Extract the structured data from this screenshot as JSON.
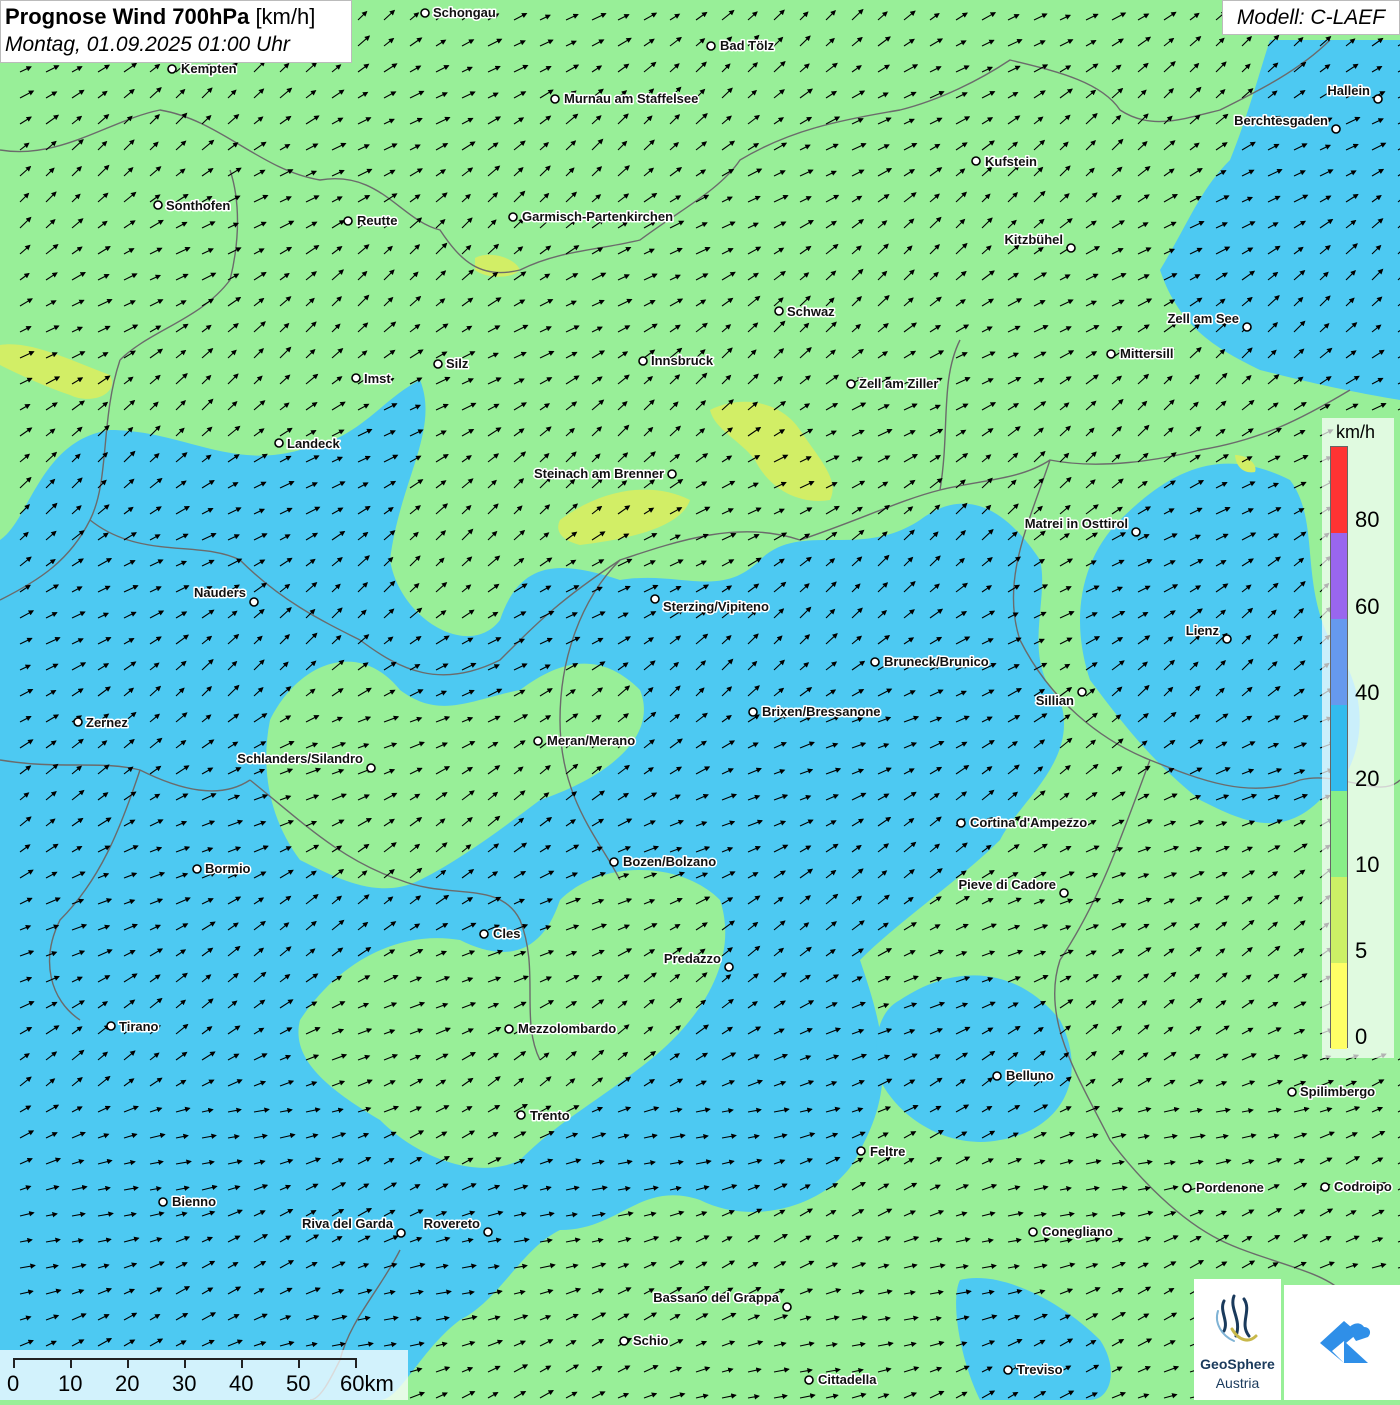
{
  "title": {
    "main": "Prognose Wind 700hPa",
    "unit": "[km/h]",
    "datetime": "Montag, 01.09.2025 01:00 Uhr"
  },
  "model": "Modell: C-LAEF",
  "legend": {
    "unit": "km/h",
    "ticks": [
      "80",
      "60",
      "40",
      "20",
      "10",
      "5",
      "0"
    ],
    "colors": [
      "#ff3333",
      "#9966ee",
      "#6699ee",
      "#33bbee",
      "#88ee88",
      "#ccf066",
      "#ffff66"
    ]
  },
  "scale_bar": {
    "labels": [
      "0",
      "10",
      "20",
      "30",
      "40",
      "50",
      "60km"
    ]
  },
  "colors": {
    "wind_0_5": "#f4f066",
    "wind_5_10": "#d2ee66",
    "wind_10_20": "#98ef98",
    "wind_20_40": "#4dc9f2",
    "arrow": "#000000",
    "border": "#6b6b6b"
  },
  "cities": [
    "Schongau",
    "Bad Tölz",
    "Kempten",
    "Murnau am Staffelsee",
    "Hallein",
    "Berchtesgaden",
    "Kufstein",
    "Sonthofen",
    "Reutte",
    "Garmisch-Partenkirchen",
    "Kitzbühel",
    "Schwaz",
    "Zell am See",
    "Mittersill",
    "Imst",
    "Silz",
    "Innsbruck",
    "Zell am Ziller",
    "Landeck",
    "Steinach am Brenner",
    "Matrei in Osttirol",
    "Nauders",
    "Sterzing/Vipiteno",
    "Lienz",
    "Bruneck/Brunico",
    "Sillian",
    "Brixen/Bressanone",
    "Zernez",
    "Meran/Merano",
    "Schlanders/Silandro",
    "Cortina d'Ampezzo",
    "Bozen/Bolzano",
    "Bormio",
    "Pieve di Cadore",
    "Cles",
    "Predazzo",
    "Tirano",
    "Mezzolombardo",
    "Belluno",
    "Spilimbergo",
    "Trento",
    "Feltre",
    "Pordenone",
    "Codroipo",
    "Bienno",
    "Riva del Garda",
    "Rovereto",
    "Conegliano",
    "Bassano del Grappa",
    "Schio",
    "Treviso",
    "Cittadella"
  ],
  "logo": {
    "name1": "GeoSphere",
    "name2": "Austria"
  }
}
